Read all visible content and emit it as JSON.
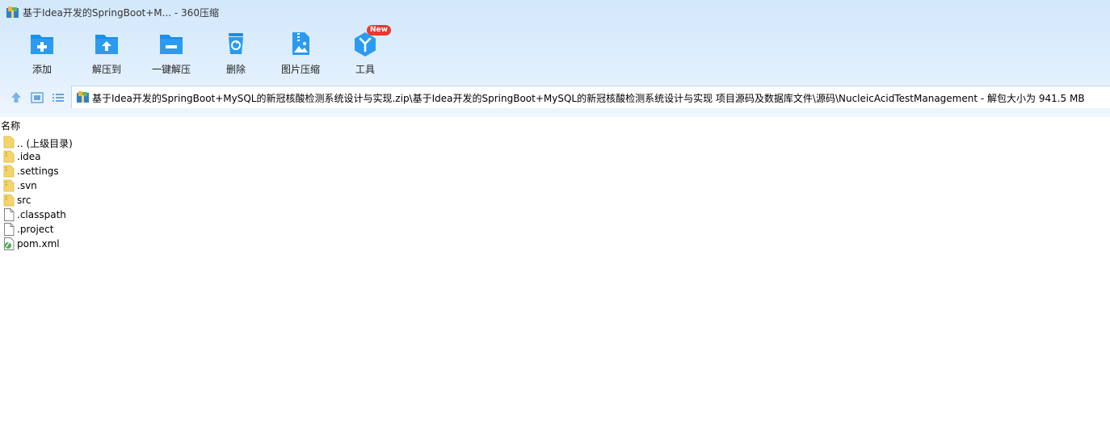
{
  "window": {
    "title": "基于Idea开发的SpringBoot+M... - 360压缩"
  },
  "toolbar": {
    "buttons": [
      {
        "label": "添加",
        "icon": "add-folder-icon"
      },
      {
        "label": "解压到",
        "icon": "extract-to-icon"
      },
      {
        "label": "一键解压",
        "icon": "one-click-extract-icon"
      },
      {
        "label": "删除",
        "icon": "trash-icon"
      },
      {
        "label": "图片压缩",
        "icon": "image-compress-icon"
      },
      {
        "label": "工具",
        "icon": "tools-icon",
        "badge": "New"
      }
    ]
  },
  "nav": {
    "up_icon": "arrow-up-icon",
    "view_icon": "thumbnail-view-icon",
    "list_icon": "list-view-icon"
  },
  "address": {
    "path": "基于Idea开发的SpringBoot+MySQL的新冠核酸检测系统设计与实现.zip\\基于Idea开发的SpringBoot+MySQL的新冠核酸检测系统设计与实现 项目源码及数据库文件\\源码\\NucleicAcidTestManagement - 解包大小为 941.5 MB"
  },
  "file_list": {
    "column_name": "名称",
    "items": [
      {
        "name": ".. (上级目录)",
        "type": "parent-folder"
      },
      {
        "name": ".idea",
        "type": "folder"
      },
      {
        "name": ".settings",
        "type": "folder"
      },
      {
        "name": ".svn",
        "type": "folder"
      },
      {
        "name": "src",
        "type": "folder"
      },
      {
        "name": ".classpath",
        "type": "file"
      },
      {
        "name": ".project",
        "type": "file"
      },
      {
        "name": "pom.xml",
        "type": "xml-file"
      }
    ]
  },
  "colors": {
    "accent": "#1a8ee8",
    "chrome_top": "#d3e8fb",
    "folder": "#f5d56b",
    "badge": "#e8392f"
  }
}
